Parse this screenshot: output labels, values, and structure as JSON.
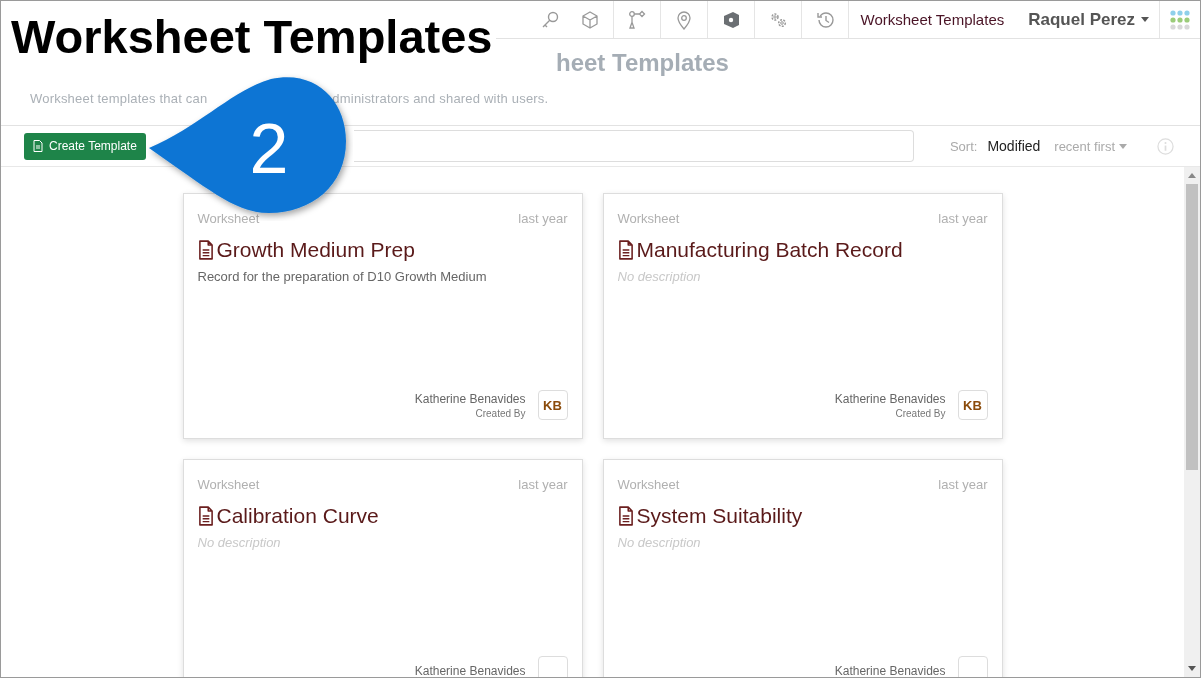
{
  "overlay": {
    "title": "Worksheet Templates",
    "step": "2"
  },
  "nav": {
    "current": "Worksheet Templates",
    "user": "Raquel Perez"
  },
  "header": {
    "title": "heet Templates",
    "description_parts": [
      "Worksheet templates that can",
      "dministrators and shared with users."
    ]
  },
  "toolbar": {
    "create_button": "Create Template",
    "sort_label": "Sort:",
    "sort_field": "Modified",
    "sort_order": "recent first"
  },
  "cards": [
    {
      "type": "Worksheet",
      "time": "last year",
      "title": "Growth Medium Prep",
      "description": "Record for the preparation of D10 Growth Medium",
      "empty": false,
      "author": "Katherine Benavides",
      "author_role": "Created By",
      "initials": "KB"
    },
    {
      "type": "Worksheet",
      "time": "last year",
      "title": "Manufacturing Batch Record",
      "description": "No description",
      "empty": true,
      "author": "Katherine Benavides",
      "author_role": "Created By",
      "initials": "KB"
    },
    {
      "type": "Worksheet",
      "time": "last year",
      "title": "Calibration Curve",
      "description": "No description",
      "empty": true,
      "author": "Katherine Benavides"
    },
    {
      "type": "Worksheet",
      "time": "last year",
      "title": "System Suitability",
      "description": "No description",
      "empty": true,
      "author": "Katherine Benavides"
    }
  ]
}
